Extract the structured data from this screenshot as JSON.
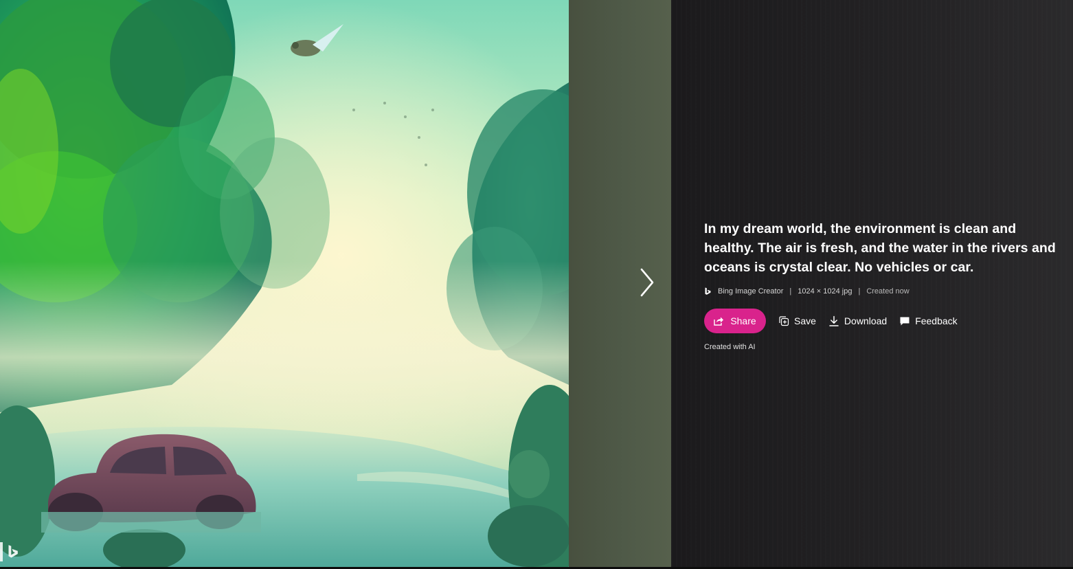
{
  "image": {
    "alt": "",
    "watermark_icon": "bing-icon"
  },
  "navigation": {
    "next_icon": "chevron-right-icon"
  },
  "details": {
    "title": "In my dream world, the environment is clean and healthy. The air is fresh, and the water in the rivers and oceans is crystal clear. No vehicles or car.",
    "meta": {
      "brand_icon": "bing-icon",
      "source": "Bing Image Creator",
      "separator": "|",
      "dimensions": "1024 × 1024 jpg",
      "status": "Created now"
    },
    "actions": {
      "share": "Share",
      "save": "Save",
      "download": "Download",
      "feedback": "Feedback"
    },
    "footnote": "Created with AI"
  },
  "colors": {
    "accent": "#d9238c",
    "panel_bg": "#222123",
    "strip_bg": "#4f5a48"
  }
}
